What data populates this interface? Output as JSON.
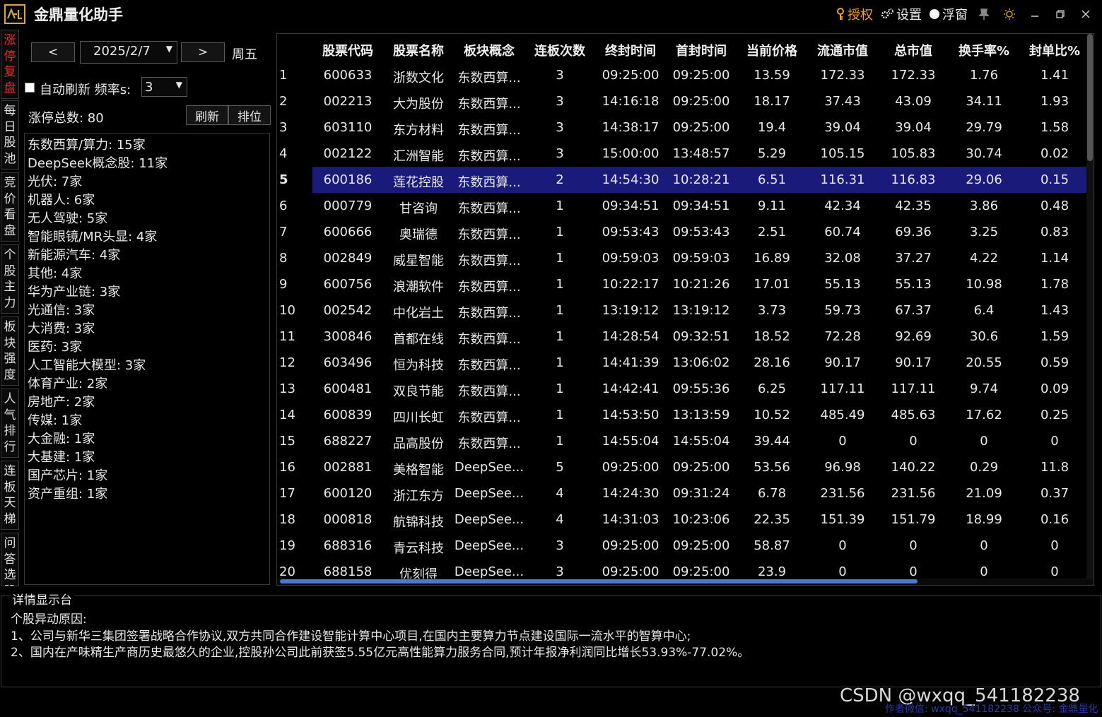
{
  "app": {
    "title": "金鼎量化助手",
    "logo_text": "金鼎"
  },
  "titlebar": {
    "auth_label": "授权",
    "settings_label": "设置",
    "float_label": "浮窗"
  },
  "vtabs": [
    {
      "label": "涨停复盘",
      "active": true
    },
    {
      "label": "每日股池",
      "active": false
    },
    {
      "label": "竞价看盘",
      "active": false
    },
    {
      "label": "个股主力",
      "active": false
    },
    {
      "label": "板块强度",
      "active": false
    },
    {
      "label": "人气排行",
      "active": false
    },
    {
      "label": "连板天梯",
      "active": false
    },
    {
      "label": "问答选股",
      "active": false
    }
  ],
  "controls": {
    "prev_label": "<",
    "next_label": ">",
    "date": "2025/2/7",
    "weekday": "周五",
    "auto_refresh_label": "自动刷新 频率s:",
    "frequency": "3",
    "total_label": "涨停总数: 80",
    "refresh_label": "刷新",
    "rank_label": "排位"
  },
  "sectors": [
    "东数西算/算力: 15家",
    "DeepSeek概念股: 11家",
    "光伏: 7家",
    "机器人: 6家",
    "无人驾驶: 5家",
    "智能眼镜/MR头显: 4家",
    "新能源汽车: 4家",
    "其他: 4家",
    "华为产业链: 3家",
    "光通信: 3家",
    "大消费: 3家",
    "医药: 3家",
    "人工智能大模型: 3家",
    "体育产业: 2家",
    "房地产: 2家",
    "传媒: 1家",
    "大金融: 1家",
    "大基建: 1家",
    "国产芯片: 1家",
    "资产重组: 1家"
  ],
  "table": {
    "columns": [
      "股票代码",
      "股票名称",
      "板块概念",
      "连板次数",
      "终封时间",
      "首封时间",
      "当前价格",
      "流通市值",
      "总市值",
      "换手率%",
      "封单比%"
    ],
    "selected_row": 5,
    "rows": [
      [
        "1",
        "600633",
        "浙数文化",
        "东数西算...",
        "3",
        "09:25:00",
        "09:25:00",
        "13.59",
        "172.33",
        "172.33",
        "1.76",
        "1.41"
      ],
      [
        "2",
        "002213",
        "大为股份",
        "东数西算...",
        "3",
        "14:16:18",
        "09:25:00",
        "18.17",
        "37.43",
        "43.09",
        "34.11",
        "1.93"
      ],
      [
        "3",
        "603110",
        "东方材料",
        "东数西算...",
        "3",
        "14:38:17",
        "09:25:00",
        "19.4",
        "39.04",
        "39.04",
        "29.79",
        "1.58"
      ],
      [
        "4",
        "002122",
        "汇洲智能",
        "东数西算...",
        "3",
        "15:00:00",
        "13:48:57",
        "5.29",
        "105.15",
        "105.83",
        "30.74",
        "0.02"
      ],
      [
        "5",
        "600186",
        "莲花控股",
        "东数西算...",
        "2",
        "14:54:30",
        "10:28:21",
        "6.51",
        "116.31",
        "116.83",
        "29.06",
        "0.15"
      ],
      [
        "6",
        "000779",
        "甘咨询",
        "东数西算...",
        "1",
        "09:34:51",
        "09:34:51",
        "9.11",
        "42.34",
        "42.35",
        "3.86",
        "0.48"
      ],
      [
        "7",
        "600666",
        "奥瑞德",
        "东数西算...",
        "1",
        "09:53:43",
        "09:53:43",
        "2.51",
        "60.74",
        "69.36",
        "3.25",
        "0.83"
      ],
      [
        "8",
        "002849",
        "威星智能",
        "东数西算...",
        "1",
        "09:59:03",
        "09:59:03",
        "16.89",
        "32.08",
        "37.27",
        "4.22",
        "1.14"
      ],
      [
        "9",
        "600756",
        "浪潮软件",
        "东数西算...",
        "1",
        "10:22:17",
        "10:21:26",
        "17.01",
        "55.13",
        "55.13",
        "10.98",
        "1.78"
      ],
      [
        "10",
        "002542",
        "中化岩土",
        "东数西算...",
        "1",
        "13:19:12",
        "13:19:12",
        "3.73",
        "59.73",
        "67.37",
        "6.4",
        "1.43"
      ],
      [
        "11",
        "300846",
        "首都在线",
        "东数西算...",
        "1",
        "14:28:54",
        "09:32:51",
        "18.52",
        "72.28",
        "92.69",
        "30.6",
        "1.59"
      ],
      [
        "12",
        "603496",
        "恒为科技",
        "东数西算...",
        "1",
        "14:41:39",
        "13:06:02",
        "28.16",
        "90.17",
        "90.17",
        "20.55",
        "0.59"
      ],
      [
        "13",
        "600481",
        "双良节能",
        "东数西算...",
        "1",
        "14:42:41",
        "09:55:36",
        "6.25",
        "117.11",
        "117.11",
        "9.74",
        "0.09"
      ],
      [
        "14",
        "600839",
        "四川长虹",
        "东数西算...",
        "1",
        "14:53:50",
        "13:13:59",
        "10.52",
        "485.49",
        "485.63",
        "17.62",
        "0.25"
      ],
      [
        "15",
        "688227",
        "品高股份",
        "东数西算...",
        "1",
        "14:55:04",
        "14:55:04",
        "39.44",
        "0",
        "0",
        "0",
        "0"
      ],
      [
        "16",
        "002881",
        "美格智能",
        "DeepSee...",
        "5",
        "09:25:00",
        "09:25:00",
        "53.56",
        "96.98",
        "140.22",
        "0.29",
        "11.8"
      ],
      [
        "17",
        "600120",
        "浙江东方",
        "DeepSee...",
        "4",
        "14:24:30",
        "09:31:24",
        "6.78",
        "231.56",
        "231.56",
        "21.09",
        "0.37"
      ],
      [
        "18",
        "000818",
        "航锦科技",
        "DeepSee...",
        "4",
        "14:31:03",
        "10:23:06",
        "22.35",
        "151.39",
        "151.79",
        "18.99",
        "0.16"
      ],
      [
        "19",
        "688316",
        "青云科技",
        "DeepSee...",
        "3",
        "09:25:00",
        "09:25:00",
        "58.87",
        "0",
        "0",
        "0",
        "0"
      ],
      [
        "20",
        "688158",
        "优刻得",
        "DeepSee...",
        "3",
        "09:25:00",
        "09:25:00",
        "23.9",
        "0",
        "0",
        "0",
        "0"
      ]
    ]
  },
  "details": {
    "title": "详情显示台",
    "heading": "个股异动原因:",
    "line1": "1、公司与新华三集团签署战略合作协议,双方共同合作建设智能计算中心项目,在国内主要算力节点建设国际一流水平的智算中心;",
    "line2": "2、国内在产味精生产商历史最悠久的企业,控股孙公司此前获签5.55亿元高性能算力服务合同,预计年报净利润同比增长53.93%-77.02%。"
  },
  "watermark": "CSDN @wxqq_541182238",
  "footer_note": "作者微信: wxqq_541182238 公众号: 金鼎量化",
  "colors": {
    "accent_orange": "#f0a030",
    "selected_row": "#1a1a7a",
    "active_tab": "#e03030",
    "scroll_thumb": "#4a7ad0"
  }
}
